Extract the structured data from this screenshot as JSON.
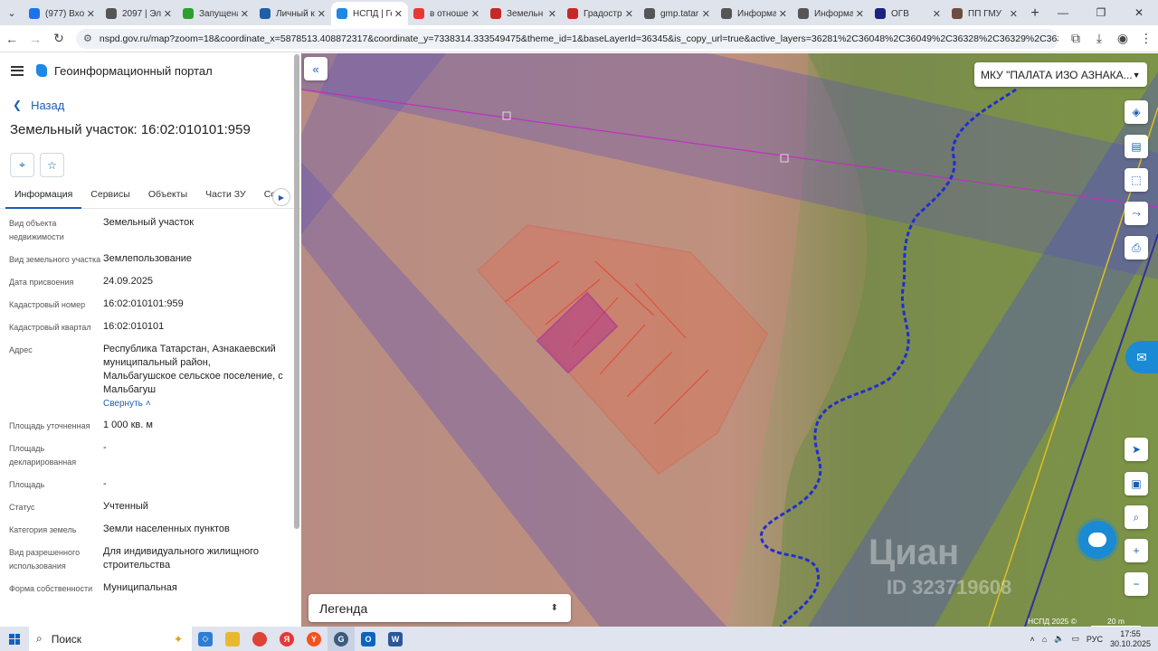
{
  "browser": {
    "tabs": [
      {
        "title": "(977) Входя",
        "color": "#1a73e8"
      },
      {
        "title": "2097 | Эле",
        "color": "#555555"
      },
      {
        "title": "Запущена",
        "color": "#2ca02c"
      },
      {
        "title": "Личный к",
        "color": "#1e5fa8"
      },
      {
        "title": "НСПД | Ге",
        "color": "#1e88e5"
      },
      {
        "title": "в отноше",
        "color": "#e53935"
      },
      {
        "title": "Земельн",
        "color": "#c62828"
      },
      {
        "title": "Градостр",
        "color": "#c62828"
      },
      {
        "title": "gmp.tatar",
        "color": "#555555"
      },
      {
        "title": "Информа",
        "color": "#555555"
      },
      {
        "title": "Информа",
        "color": "#555555"
      },
      {
        "title": "ОГВ",
        "color": "#1a237e"
      },
      {
        "title": "ПП ГМУ",
        "color": "#6d4c41"
      }
    ],
    "url": "nspd.gov.ru/map?zoom=18&coordinate_x=5878513.408872317&coordinate_y=7338314.333549475&theme_id=1&baseLayerId=36345&is_copy_url=true&active_layers=36281%2C36048%2C36049%2C36328%2C36329%2C36315%2C37578%2C3758..."
  },
  "sidebar": {
    "portal_title": "Геоинформационный портал",
    "back_label": "Назад",
    "parcel_title": "Земельный участок: 16:02:010101:959",
    "tabs": [
      "Информация",
      "Сервисы",
      "Объекты",
      "Части ЗУ",
      "Соста"
    ],
    "props": [
      {
        "label": "Вид объекта недвижимости",
        "value": "Земельный участок"
      },
      {
        "label": "Вид земельного участка",
        "value": "Землепользование"
      },
      {
        "label": "Дата присвоения",
        "value": "24.09.2025"
      },
      {
        "label": "Кадастровый номер",
        "value": "16:02:010101:959"
      },
      {
        "label": "Кадастровый квартал",
        "value": "16:02:010101"
      },
      {
        "label": "Адрес",
        "value": "Республика Татарстан, Азнакаевский муниципальный район, Мальбагушское сельское поселение, с Мальбагуш"
      },
      {
        "label": "Площадь уточненная",
        "value": "1 000 кв. м"
      },
      {
        "label": "Площадь декларированная",
        "value": "-"
      },
      {
        "label": "Площадь",
        "value": "-"
      },
      {
        "label": "Статус",
        "value": "Учтенный"
      },
      {
        "label": "Категория земель",
        "value": "Земли населенных пунктов"
      },
      {
        "label": "Вид разрешенного использования",
        "value": "Для индивидуального жилищного строительства"
      },
      {
        "label": "Форма собственности",
        "value": "Муниципальная"
      }
    ],
    "collapse_label": "Свернуть"
  },
  "map": {
    "org_select": "МКУ \"ПАЛАТА ИЗО АЗНАКА...",
    "legend_label": "Легенда",
    "copyright": "НСПД 2025 ©",
    "scale": "20 m",
    "watermark": "Циан",
    "watermark_sub": "ID 323719608"
  },
  "taskbar": {
    "search_label": "Поиск",
    "lang": "РУС",
    "time": "17:55",
    "date": "30.10.2025"
  }
}
